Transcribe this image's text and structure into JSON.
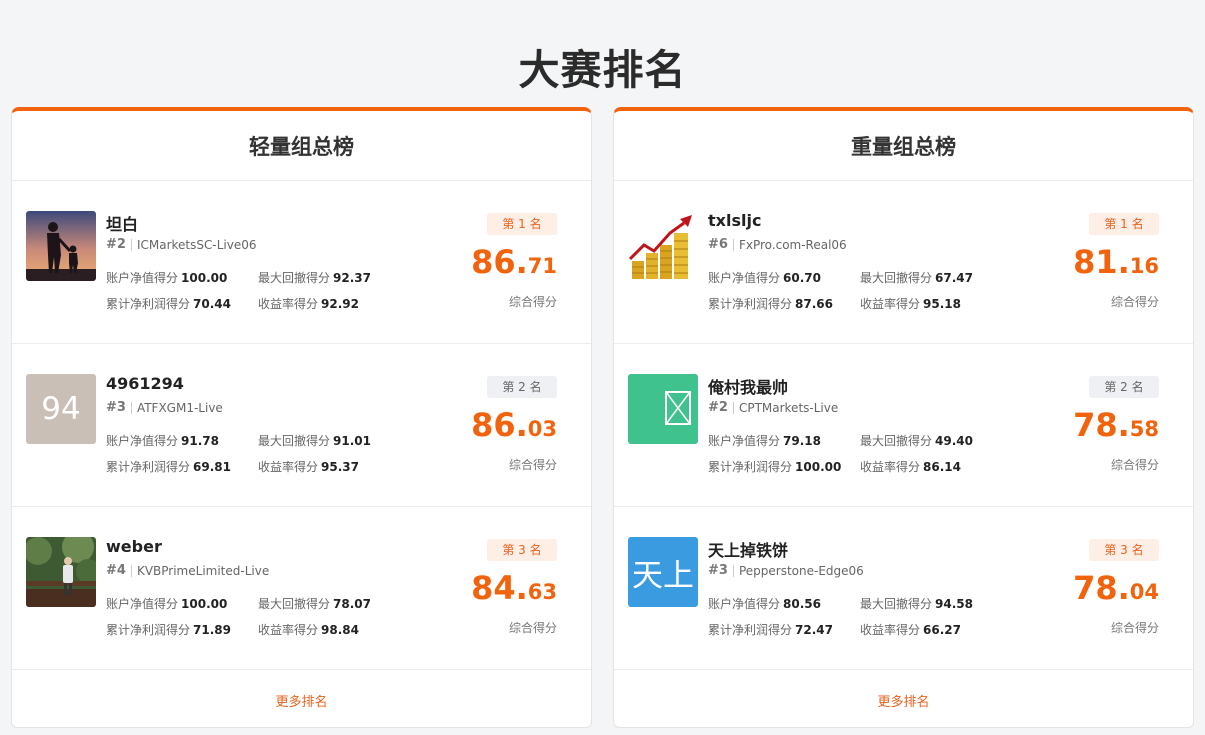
{
  "title": "大赛排名",
  "score_label": "综合得分",
  "stat_labels": {
    "equity": "账户净值得分",
    "drawdown": "最大回撤得分",
    "profit": "累计净利润得分",
    "return": "收益率得分"
  },
  "more_label": "更多排名",
  "boards": [
    {
      "title": "轻量组总榜",
      "entries": [
        {
          "name": "坦白",
          "rank": "#2",
          "account": "ICMarketsSC-Live06",
          "place": "第 1 名",
          "score_int": "86.",
          "score_dec": "71",
          "equity": "100.00",
          "drawdown": "92.37",
          "profit": "70.44",
          "return": "92.92",
          "avatar_icon": "silhouette-photo"
        },
        {
          "name": "4961294",
          "rank": "#3",
          "account": "ATFXGM1-Live",
          "place": "第 2 名",
          "score_int": "86.",
          "score_dec": "03",
          "equity": "91.78",
          "drawdown": "91.01",
          "profit": "69.81",
          "return": "95.37",
          "avatar_text": "94",
          "avatar_color": "#c9bfb7"
        },
        {
          "name": "weber",
          "rank": "#4",
          "account": "KVBPrimeLimited-Live",
          "place": "第 3 名",
          "score_int": "84.",
          "score_dec": "63",
          "equity": "100.00",
          "drawdown": "78.07",
          "profit": "71.89",
          "return": "98.84",
          "avatar_icon": "garden-photo"
        }
      ]
    },
    {
      "title": "重量组总榜",
      "entries": [
        {
          "name": "txlsljc",
          "rank": "#6",
          "account": "FxPro.com-Real06",
          "place": "第 1 名",
          "score_int": "81.",
          "score_dec": "16",
          "equity": "60.70",
          "drawdown": "67.47",
          "profit": "87.66",
          "return": "95.18",
          "avatar_icon": "gold-coins-photo"
        },
        {
          "name": "俺村我最帅",
          "rank": "#2",
          "account": "CPTMarkets-Live",
          "place": "第 2 名",
          "score_int": "78.",
          "score_dec": "58",
          "equity": "79.18",
          "drawdown": "49.40",
          "profit": "100.00",
          "return": "86.14",
          "avatar_icon": "broken-image-icon",
          "avatar_color": "#3fc28d"
        },
        {
          "name": "天上掉铁饼",
          "rank": "#3",
          "account": "Pepperstone-Edge06",
          "place": "第 3 名",
          "score_int": "78.",
          "score_dec": "04",
          "equity": "80.56",
          "drawdown": "94.58",
          "profit": "72.47",
          "return": "66.27",
          "avatar_text": "天上",
          "avatar_color": "#3b9be1"
        }
      ]
    }
  ]
}
